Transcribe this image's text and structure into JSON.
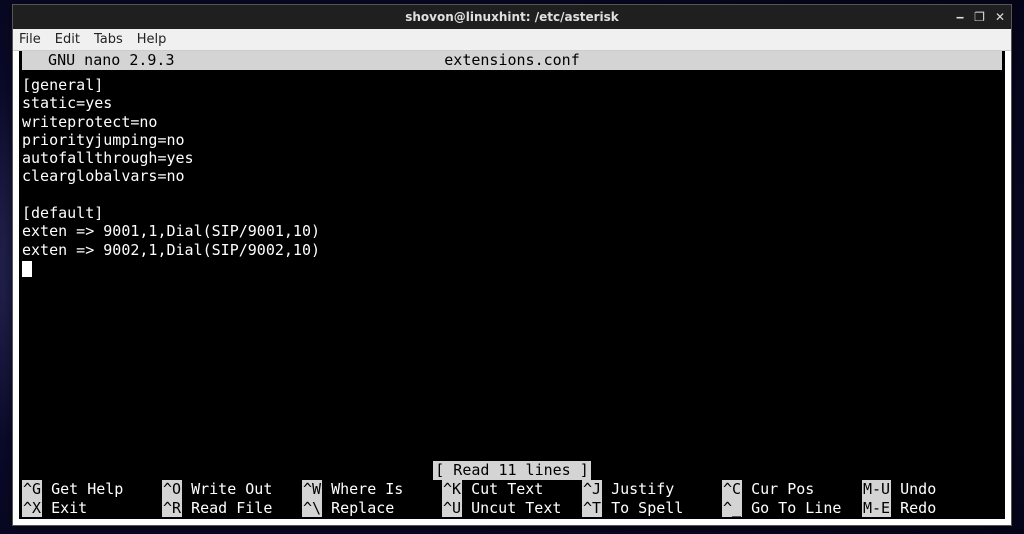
{
  "window": {
    "title": "shovon@linuxhint: /etc/asterisk",
    "controls": {
      "min": "‒",
      "max": "❐",
      "close": "✕"
    }
  },
  "menubar": {
    "file": "File",
    "edit": "Edit",
    "tabs": "Tabs",
    "help": "Help"
  },
  "nano": {
    "app": "  GNU nano 2.9.3",
    "filename": "extensions.conf",
    "status": "[ Read 11 lines ]",
    "content": "[general]\nstatic=yes\nwriteprotect=no\npriorityjumping=no\nautofallthrough=yes\nclearglobalvars=no\n\n[default]\nexten => 9001,1,Dial(SIP/9001,10)\nexten => 9002,1,Dial(SIP/9002,10)\n",
    "shortcuts": {
      "row1": [
        {
          "key": "^G",
          "label": " Get Help "
        },
        {
          "key": "^O",
          "label": " Write Out"
        },
        {
          "key": "^W",
          "label": " Where Is "
        },
        {
          "key": "^K",
          "label": " Cut Text "
        },
        {
          "key": "^J",
          "label": " Justify  "
        },
        {
          "key": "^C",
          "label": " Cur Pos  "
        },
        {
          "key": "M-U",
          "label": " Undo"
        }
      ],
      "row2": [
        {
          "key": "^X",
          "label": " Exit     "
        },
        {
          "key": "^R",
          "label": " Read File"
        },
        {
          "key": "^\\",
          "label": " Replace  "
        },
        {
          "key": "^U",
          "label": " Uncut Text"
        },
        {
          "key": "^T",
          "label": " To Spell "
        },
        {
          "key": "^_",
          "label": " Go To Line"
        },
        {
          "key": "M-E",
          "label": " Redo"
        }
      ]
    }
  }
}
